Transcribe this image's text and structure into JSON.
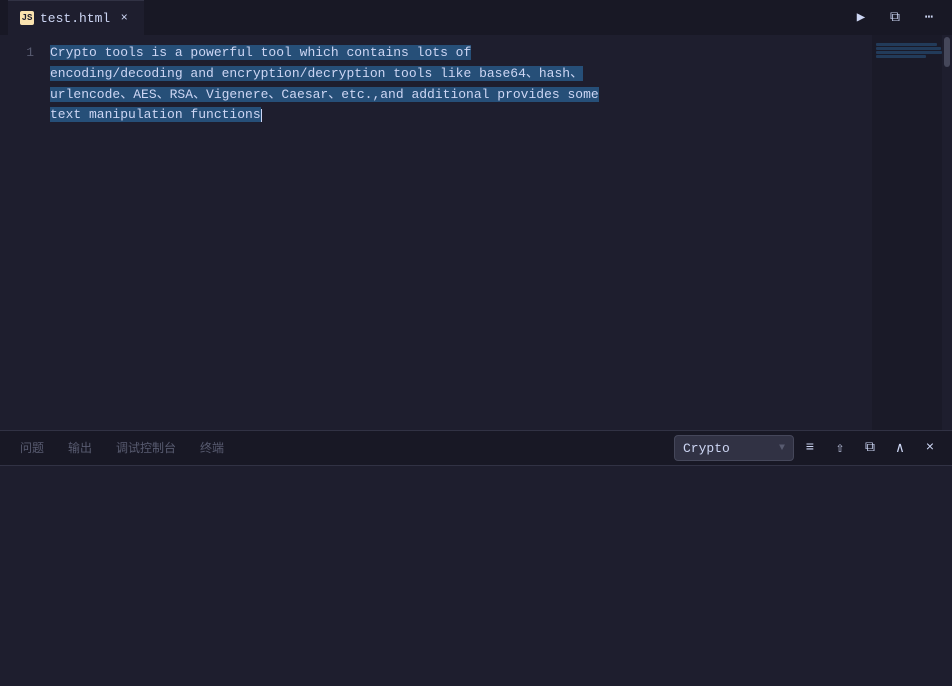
{
  "titleBar": {
    "tab": {
      "label": "test.html",
      "icon": "JS",
      "close_label": "×"
    },
    "actions": {
      "run_label": "▶",
      "split_label": "⧉",
      "more_label": "⋯"
    }
  },
  "editor": {
    "lineNumbers": [
      "1"
    ],
    "code": {
      "full": "Crypto tools is a powerful tool which contains lots of\nencoding/decoding and encryption/decryption tools like base64、hash、\nurlencode、AES、RSA、Vigenere、Caesar、etc.,and additional provides some\ntext manipulation functions"
    }
  },
  "panel": {
    "tabs": [
      {
        "label": "问题",
        "active": false
      },
      {
        "label": "输出",
        "active": false
      },
      {
        "label": "调试控制台",
        "active": false
      },
      {
        "label": "终端",
        "active": false
      }
    ],
    "dropdown": {
      "value": "Crypto",
      "arrow": "▼"
    },
    "actions": {
      "list_icon": "≡",
      "share_icon": "⇧",
      "copy_icon": "⧉",
      "chevron_up": "∧",
      "close_icon": "×"
    }
  }
}
